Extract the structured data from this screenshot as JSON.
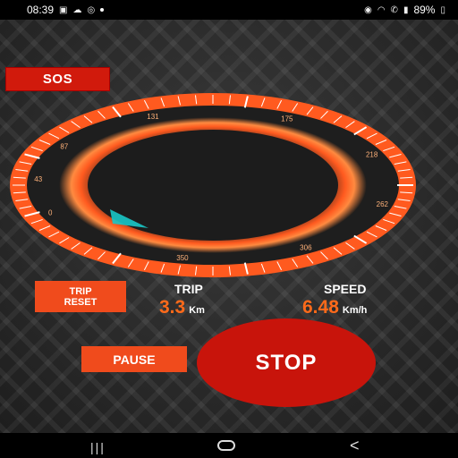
{
  "status_bar": {
    "time": "08:39",
    "battery": "89%",
    "left_icons": [
      "image-icon",
      "cloud-icon",
      "instagram-icon",
      "dot-icon"
    ],
    "right_icons": [
      "location-icon",
      "wifi-icon",
      "call-icon",
      "signal-icon",
      "battery-icon"
    ]
  },
  "sos": {
    "label": "SOS"
  },
  "dial": {
    "tick_labels": [
      "0",
      "43",
      "87",
      "131",
      "175",
      "218",
      "262",
      "306",
      "350"
    ],
    "colors": {
      "ring": "#ff5a1f",
      "tick": "#ffffff",
      "pointer": "#19c8c8",
      "face": "#1e1e1e"
    }
  },
  "trip": {
    "reset_line1": "TRIP",
    "reset_line2": "RESET",
    "label": "TRIP",
    "value": "3.3",
    "unit": "Km"
  },
  "speed": {
    "label": "SPEED",
    "value": "6.48",
    "unit": "Km/h"
  },
  "controls": {
    "pause_label": "PAUSE",
    "stop_label": "STOP"
  },
  "nav": {
    "recents": "|||",
    "back": "<"
  }
}
